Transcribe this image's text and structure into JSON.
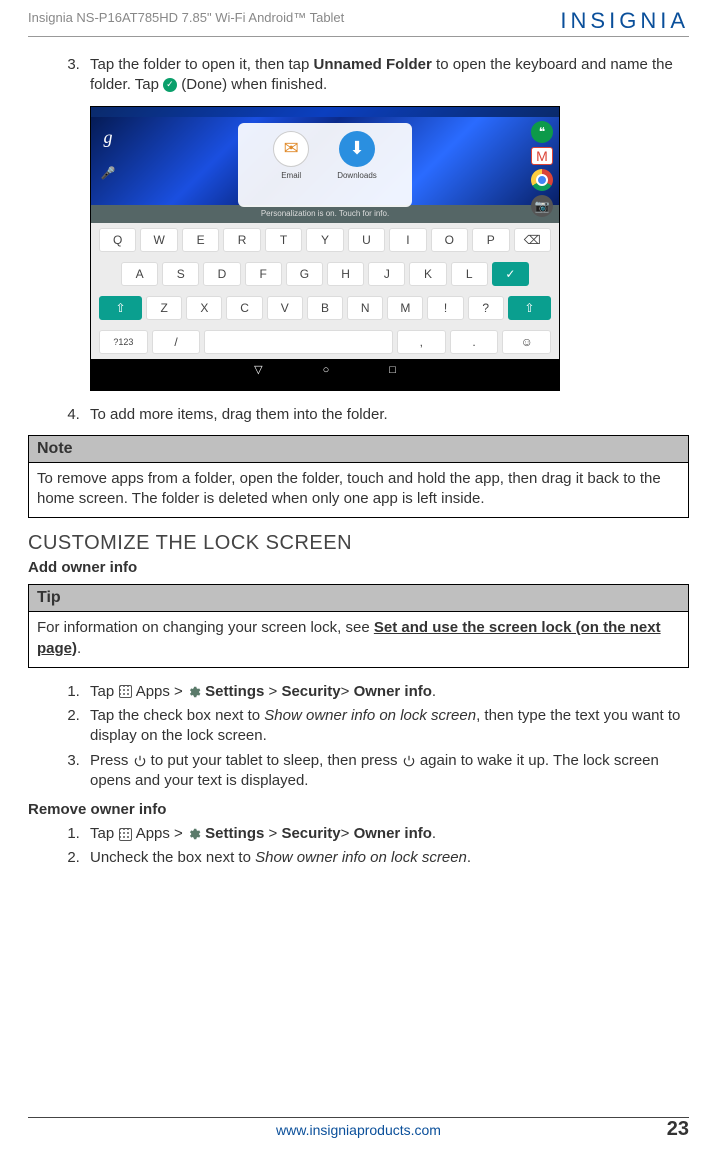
{
  "header": {
    "product_line": "Insignia  NS-P16AT785HD  7.85\" Wi-Fi Android™ Tablet",
    "brand": "INSIGNIA"
  },
  "step3": {
    "pre": "Tap the folder to open it, then tap ",
    "bold1": "Unnamed Folder",
    "mid": " to open the keyboard and name the folder. Tap ",
    "post": " (Done) when finished."
  },
  "screenshot": {
    "folder_apps": [
      "Email",
      "Downloads"
    ],
    "toast": "Personalization is on. Touch for info.",
    "kb_row1": [
      "Q",
      "W",
      "E",
      "R",
      "T",
      "Y",
      "U",
      "I",
      "O",
      "P"
    ],
    "kb_row2": [
      "A",
      "S",
      "D",
      "F",
      "G",
      "H",
      "J",
      "K",
      "L"
    ],
    "kb_row3": [
      "Z",
      "X",
      "C",
      "V",
      "B",
      "N",
      "M",
      "!",
      "?"
    ],
    "kb_sym": "?123"
  },
  "step4": "To add more items, drag them into the folder.",
  "note": {
    "title": "Note",
    "body": "To remove apps from a folder, open the folder, touch and hold the app, then drag it back to the home screen. The folder is deleted when only one app is left inside."
  },
  "section_title": "CUSTOMIZE THE LOCK SCREEN",
  "add_owner_heading": "Add owner info",
  "tip": {
    "title": "Tip",
    "pre": "For information on changing your screen lock, see ",
    "link": "Set and use the screen lock (on the next page)",
    "post": "."
  },
  "add_steps": {
    "s1": {
      "pre": "Tap ",
      "apps": " Apps > ",
      "settings": " Settings",
      "gt1": " > ",
      "security": "Security",
      "gt2": "> ",
      "owner": "Owner info",
      "end": "."
    },
    "s2": {
      "pre": "Tap the check box next to ",
      "ital": "Show owner info on lock screen",
      "post": ", then type the text you want to display on the lock screen."
    },
    "s3": {
      "pre": "Press ",
      "mid": " to put your tablet to sleep, then press ",
      "post": " again to wake it up. The lock screen opens and your text is displayed."
    }
  },
  "remove_owner_heading": "Remove owner info",
  "remove_steps": {
    "s1": {
      "pre": "Tap ",
      "apps": " Apps > ",
      "settings": " Settings",
      "gt1": " > ",
      "security": "Security",
      "gt2": "> ",
      "owner": "Owner info",
      "end": "."
    },
    "s2": {
      "pre": "Uncheck the box next to ",
      "ital": "Show owner info on lock screen",
      "post": "."
    }
  },
  "footer": {
    "url": "www.insigniaproducts.com",
    "page": "23"
  }
}
